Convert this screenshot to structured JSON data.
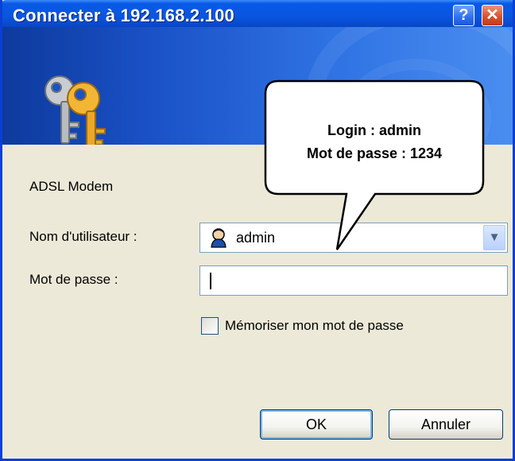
{
  "window": {
    "title": "Connecter à 192.168.2.100",
    "help_label": "?",
    "close_label": "✕"
  },
  "dialog": {
    "realm": "ADSL Modem",
    "username_label": "Nom d'utilisateur :",
    "username_value": "admin",
    "password_label": "Mot de passe :",
    "password_value": "",
    "remember_label": "Mémoriser mon mot de passe",
    "remember_checked": false,
    "ok_label": "OK",
    "cancel_label": "Annuler"
  },
  "callout": {
    "line1": "Login : admin",
    "line2": "Mot de passe : 1234"
  },
  "icons": {
    "banner": "keys-icon",
    "user": "user-icon",
    "dropdown": "chevron-down-icon"
  },
  "colors": {
    "title_bar": "#0a56e0",
    "banner": "#1b52c8",
    "accent_stripe": "#f0a030",
    "dialog_bg": "#ece9d8"
  }
}
